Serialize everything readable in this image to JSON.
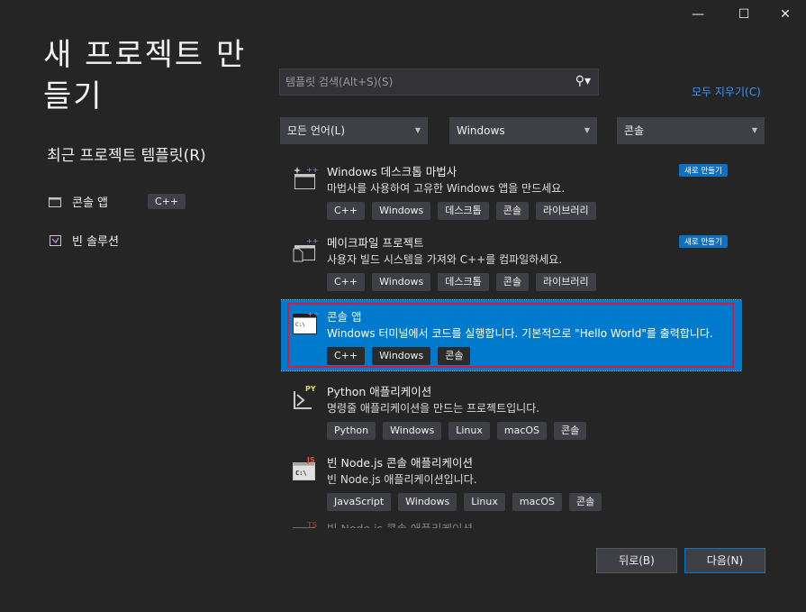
{
  "window": {
    "minimize": "—",
    "maximize": "☐",
    "close": "✕"
  },
  "page_title": "새 프로젝트 만들기",
  "recent": {
    "title": "최근 프로젝트 템플릿(R)",
    "items": [
      {
        "name": "콘솔 앱",
        "tag": "C++",
        "icon": "console-app-icon"
      },
      {
        "name": "빈 솔루션",
        "tag": "",
        "icon": "empty-solution-icon"
      }
    ]
  },
  "search": {
    "placeholder": "템플릿 검색(Alt+S)(S)",
    "icon": "search-icon"
  },
  "clear_all": "모두 지우기(C)",
  "filters": {
    "language": "모든 언어(L)",
    "platform": "Windows",
    "project_type": "콘솔"
  },
  "templates": [
    {
      "name": "Windows 데스크톱 마법사",
      "desc": "마법사를 사용하여 고유한 Windows 앱을 만드세요.",
      "tags": [
        "C++",
        "Windows",
        "데스크톱",
        "콘솔",
        "라이브러리"
      ],
      "badge": "새로 만들기",
      "icon": "desktop-wizard-icon"
    },
    {
      "name": "메이크파일 프로젝트",
      "desc": "사용자 빌드 시스템을 가져와 C++를 컴파일하세요.",
      "tags": [
        "C++",
        "Windows",
        "데스크톱",
        "콘솔",
        "라이브러리"
      ],
      "badge": "새로 만들기",
      "icon": "makefile-project-icon"
    },
    {
      "name": "콘솔 앱",
      "desc": "Windows 터미널에서 코드를 실행합니다. 기본적으로 \"Hello World\"를 출력합니다.",
      "tags": [
        "C++",
        "Windows",
        "콘솔"
      ],
      "badge": "",
      "icon": "console-app-icon",
      "selected": true
    },
    {
      "name": "Python 애플리케이션",
      "desc": "명령줄 애플리케이션을 만드는 프로젝트입니다.",
      "tags": [
        "Python",
        "Windows",
        "Linux",
        "macOS",
        "콘솔"
      ],
      "badge": "",
      "icon": "python-app-icon"
    },
    {
      "name": "빈 Node.js 콘솔 애플리케이션",
      "desc": "빈 Node.js 애플리케이션입니다.",
      "tags": [
        "JavaScript",
        "Windows",
        "Linux",
        "macOS",
        "콘솔"
      ],
      "badge": "",
      "icon": "nodejs-console-icon"
    },
    {
      "name": "빈 Node.js 콘솔 애플리케이션",
      "desc": "",
      "tags": [],
      "badge": "",
      "icon": "typescript-console-icon"
    }
  ],
  "buttons": {
    "back": "뒤로(B)",
    "next": "다음(N)"
  },
  "colors": {
    "accent": "#007acc",
    "selection_border": "#d7193d",
    "link": "#3794ff",
    "background": "#252526"
  }
}
